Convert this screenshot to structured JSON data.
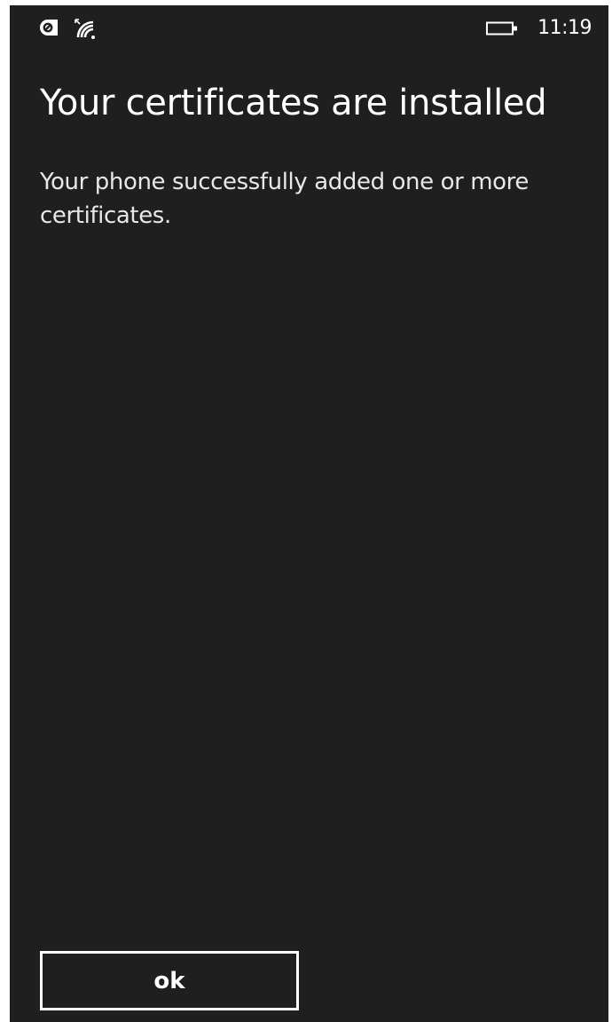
{
  "status_bar": {
    "left_icons": [
      "notification-icon",
      "wifi-signal-icon"
    ],
    "battery_icon": "battery-icon",
    "time": "11:19"
  },
  "dialog": {
    "title": "Your certificates are installed",
    "message": "Your phone successfully added one or more certificates.",
    "ok_label": "ok"
  },
  "colors": {
    "background": "#1f1f1f",
    "text": "#ffffff",
    "outer": "#ffffff"
  }
}
